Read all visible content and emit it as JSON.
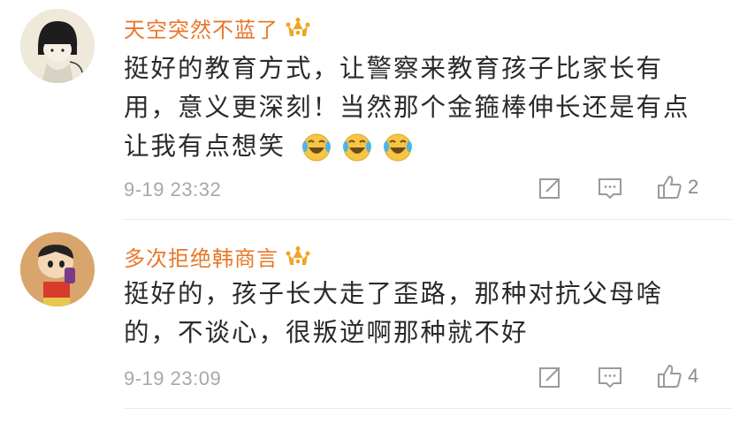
{
  "comments": [
    {
      "username": "天空突然不蓝了",
      "line1": "挺好的教育方式，让警察来教育孩子比家长有",
      "line2": "用，意义更深刻！当然那个金箍棒伸长还是有点",
      "line3": "让我有点想笑",
      "emoji_names": [
        "laugh-cry-icon",
        "laugh-cry-icon",
        "laugh-cry-icon"
      ],
      "time": "9-19 23:32",
      "likes": "2"
    },
    {
      "username": "多次拒绝韩商言",
      "line1": "挺好的，孩子长大走了歪路，那种对抗父母啥",
      "line2": "的，不谈心，很叛逆啊那种就不好",
      "time": "9-19 23:09",
      "likes": "4"
    }
  ],
  "colors": {
    "username": "#e8772a",
    "text": "#2a2a2a",
    "meta": "#a8a8a8",
    "crown": "#f0a01c"
  }
}
